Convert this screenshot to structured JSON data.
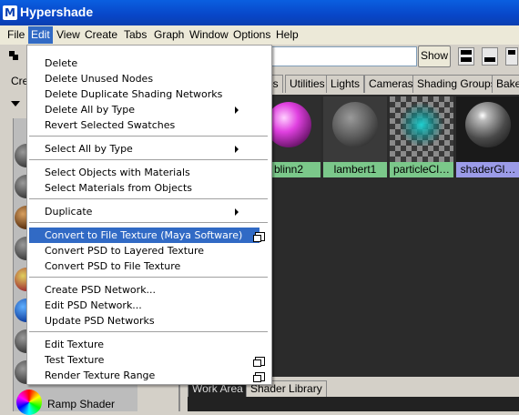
{
  "window": {
    "title": "Hypershade",
    "logo": "M"
  },
  "menubar": [
    "File",
    "Edit",
    "View",
    "Create",
    "Tabs",
    "Graph",
    "Window",
    "Options",
    "Help"
  ],
  "toolbar": {
    "show_label": "Show",
    "create_partial": "Cre"
  },
  "tabs": [
    "es",
    "Utilities",
    "Lights",
    "Cameras",
    "Shading Groups",
    "Bake"
  ],
  "swatches": [
    {
      "label": "blinn2",
      "color": "#e040e0"
    },
    {
      "label": "lambert1",
      "color": "#707070"
    },
    {
      "label": "particleCl…",
      "color": "#1fa8a8"
    },
    {
      "label": "shaderGl…",
      "color": "#c8c8c8"
    }
  ],
  "bottom_tabs": [
    "Work Area",
    "Shader Library"
  ],
  "library": {
    "ramp_label": "Ramp Shader"
  },
  "edit_menu": {
    "items": [
      "Delete",
      "Delete Unused Nodes",
      "Delete Duplicate Shading Networks",
      "Delete All by Type",
      "Revert Selected Swatches",
      "Select All by Type",
      "Select Objects with Materials",
      "Select Materials from Objects",
      "Duplicate",
      "Convert to File Texture (Maya Software)",
      "Convert PSD to Layered Texture",
      "Convert PSD to File Texture",
      "Create PSD Network...",
      "Edit PSD Network...",
      "Update PSD Networks",
      "Edit Texture",
      "Test Texture",
      "Render Texture Range"
    ]
  },
  "icons": {
    "submenu": "submenu-arrow-icon",
    "option_box": "option-box-icon"
  },
  "colors": {
    "highlight": "#316ac5",
    "titlebar": "#0a46c8",
    "swatch_label": "#7bc88a",
    "swatch_selected": "#9b9be8"
  }
}
